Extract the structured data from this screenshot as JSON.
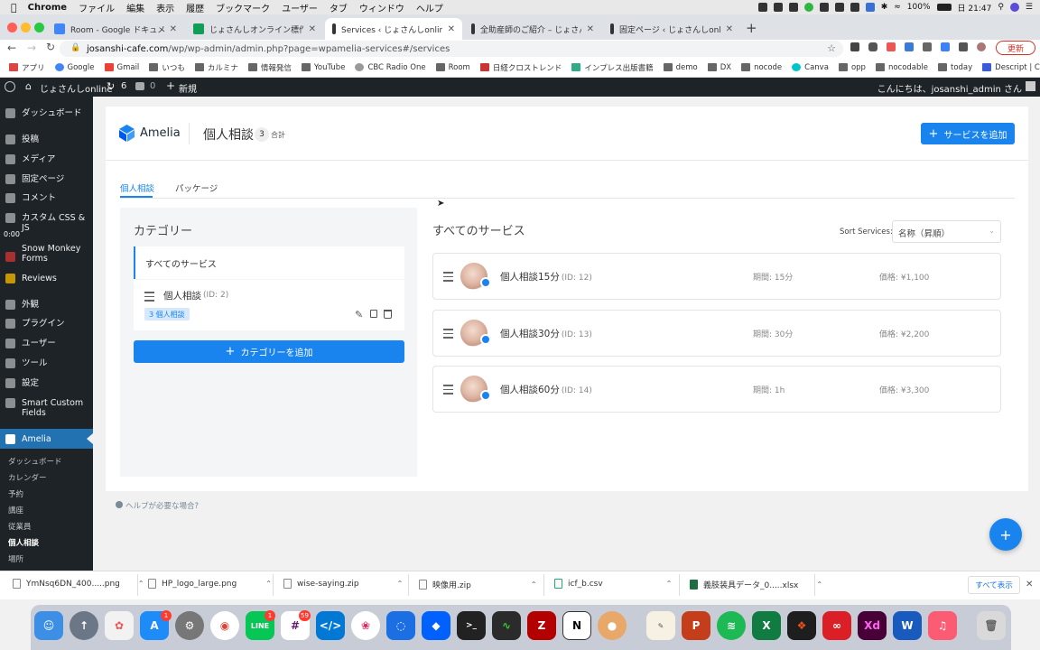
{
  "macos": {
    "app_name": "Chrome",
    "menus": [
      "ファイル",
      "編集",
      "表示",
      "履歴",
      "ブックマーク",
      "ユーザー",
      "タブ",
      "ウィンドウ",
      "ヘルプ"
    ],
    "battery": "100%",
    "clock": "日 21:47"
  },
  "browser": {
    "tabs": [
      {
        "title": "Room - Google ドキュメント",
        "color": "#4285f4"
      },
      {
        "title": "じょさんしオンライン標作業工程表",
        "color": "#0f9d58"
      },
      {
        "title": "Services ‹ じょさんしonline — W",
        "color": "#333333",
        "active": true
      },
      {
        "title": "全助産師のご紹介 – じょさんしonl",
        "color": "#333333"
      },
      {
        "title": "固定ページ ‹ じょさんしonline —",
        "color": "#333333"
      }
    ],
    "new_tab": "+",
    "url_domain": "josanshi-cafe.com",
    "url_path": "/wp/wp-admin/admin.php?page=wpamelia-services#/services",
    "update_button": "更新",
    "bookmarks": [
      "アプリ",
      "Google",
      "Gmail",
      "いつも",
      "カルミナ",
      "情報発信",
      "YouTube",
      "CBC Radio One",
      "Room",
      "日経クロストレンド",
      "インプレス出版書籍",
      "demo",
      "DX",
      "nocode",
      "Canva",
      "opp",
      "nocodable",
      "today",
      "Descript | Create..."
    ]
  },
  "wp_admin_bar": {
    "site_name": "じょさんしonline",
    "updates": "6",
    "comments": "0",
    "new": "新規",
    "greeting": "こんにちは、josanshi_admin さん"
  },
  "wp_sidebar": {
    "items": [
      "ダッシュボード",
      "投稿",
      "メディア",
      "固定ページ",
      "コメント",
      "カスタム CSS & JS",
      "Snow Monkey Forms",
      "Reviews",
      "外観",
      "プラグイン",
      "ユーザー",
      "ツール",
      "設定",
      "Smart Custom Fields",
      "Amelia"
    ],
    "video_time": "0:00",
    "amelia_sub": [
      "ダッシュボード",
      "カレンダー",
      "予約",
      "講座",
      "従業員",
      "個人相談",
      "場所"
    ]
  },
  "amelia": {
    "brand": "Amelia",
    "page_title": "個人相談",
    "count": "3",
    "count_label": "合計",
    "add_service_button": "サービスを追加",
    "tabs": [
      "個人相談",
      "パッケージ"
    ],
    "categories": {
      "heading": "カテゴリー",
      "all_services": "すべてのサービス",
      "item_name": "個人相談",
      "item_id": "(ID: 2)",
      "item_tag": "3 個人相談",
      "add_category_button": "カテゴリーを追加"
    },
    "services": {
      "heading": "すべてのサービス",
      "sort_label": "Sort Services:",
      "sort_value": "名称（昇順）",
      "list": [
        {
          "name": "個人相談15分",
          "id": "(ID: 12)",
          "duration": "期間: 15分",
          "price": "価格: ¥1,100"
        },
        {
          "name": "個人相談30分",
          "id": "(ID: 13)",
          "duration": "期間: 30分",
          "price": "価格: ¥2,200"
        },
        {
          "name": "個人相談60分",
          "id": "(ID: 14)",
          "duration": "期間: 1h",
          "price": "価格: ¥3,300"
        }
      ]
    },
    "help_link": "ヘルプが必要な場合?",
    "fab": "+"
  },
  "downloads": {
    "files": [
      "YmNsq6DN_400.....png",
      "HP_logo_large.png",
      "wise-saying.zip",
      "映像用.zip",
      "icf_b.csv",
      "義肢装具データ_0.....xlsx"
    ],
    "show_all": "すべて表示"
  },
  "dock": {
    "badges": {
      "appstore": "1",
      "line": "1",
      "slack": "59"
    }
  }
}
